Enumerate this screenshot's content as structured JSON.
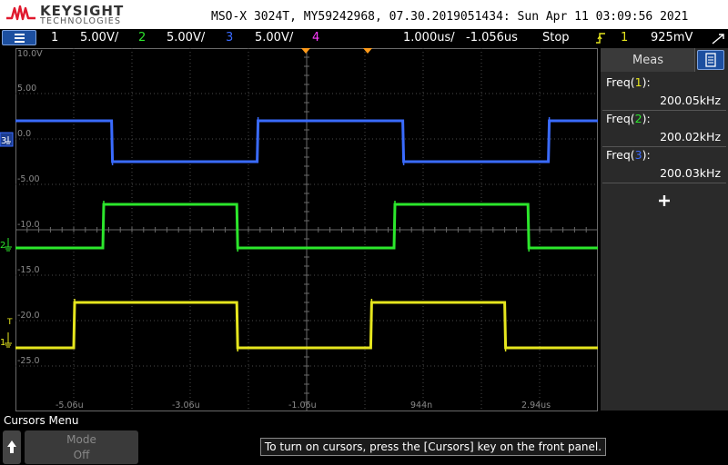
{
  "header": {
    "brand": "KEYSIGHT",
    "brand_sub": "TECHNOLOGIES",
    "title": "MSO-X 3024T, MY59242968, 07.30.2019051434: Sun Apr 11 03:09:56 2021"
  },
  "channel_bar": {
    "ch1": {
      "num": "1",
      "scale": "5.00V/",
      "color": "#e6e61e"
    },
    "ch2": {
      "num": "2",
      "scale": "5.00V/",
      "color": "#2ce62c"
    },
    "ch3": {
      "num": "3",
      "scale": "5.00V/",
      "color": "#3a6bff"
    },
    "ch4": {
      "num": "4",
      "color": "#ff3cff"
    },
    "timebase": "1.000us/",
    "delay": "-1.056us",
    "run_state": "Stop",
    "trigger_source": "1",
    "trigger_level": "925mV"
  },
  "graticule": {
    "y_labels": [
      "10.0V",
      "5.00",
      "0.0",
      "-5.00",
      "-10.0",
      "-15.0",
      "-20.0",
      "-25.0"
    ],
    "x_labels": [
      "-5.06u",
      "-3.06u",
      "-1.06u",
      "944n",
      "2.94us"
    ],
    "channel_markers": {
      "ch3": "3",
      "ch2": "2",
      "ch1": "1",
      "trigger": "T"
    }
  },
  "measurements": {
    "title": "Meas",
    "items": [
      {
        "prefix": "Freq(",
        "ch": "1",
        "suffix": "):",
        "value": "200.05kHz",
        "color": "#e6e61e"
      },
      {
        "prefix": "Freq(",
        "ch": "2",
        "suffix": "):",
        "value": "200.02kHz",
        "color": "#2ce62c"
      },
      {
        "prefix": "Freq(",
        "ch": "3",
        "suffix": "):",
        "value": "200.03kHz",
        "color": "#3a6bff"
      }
    ]
  },
  "softkeys": {
    "title": "Cursors Menu",
    "mode_label": "Mode",
    "mode_value": "Off",
    "hint": "To turn on cursors, press the [Cursors] key on the front panel."
  },
  "chart_data": {
    "type": "line",
    "xlabel": "",
    "ylabel": "",
    "xlim": [
      -6.056,
      3.944
    ],
    "ylim": [
      -30,
      10
    ],
    "grid": true,
    "series": [
      {
        "color": "#3a6bff",
        "low": -2.5,
        "high": 2.0,
        "edges": [
          {
            "t": -4.406,
            "to": "low"
          },
          {
            "t": -1.906,
            "to": "high"
          },
          {
            "t": 0.594,
            "to": "low"
          },
          {
            "t": 3.094,
            "to": "high"
          }
        ]
      },
      {
        "color": "#2ce62c",
        "low": -12.0,
        "high": -7.2,
        "edges": [
          {
            "t": -4.556,
            "to": "high"
          },
          {
            "t": -2.256,
            "to": "low"
          },
          {
            "t": 0.444,
            "to": "high"
          },
          {
            "t": 2.744,
            "to": "low"
          }
        ]
      },
      {
        "color": "#e6e61e",
        "low": -23.0,
        "high": -18.0,
        "edges": [
          {
            "t": -5.056,
            "to": "high"
          },
          {
            "t": -2.256,
            "to": "low"
          },
          {
            "t": 0.044,
            "to": "high"
          },
          {
            "t": 2.344,
            "to": "low"
          }
        ]
      }
    ]
  }
}
